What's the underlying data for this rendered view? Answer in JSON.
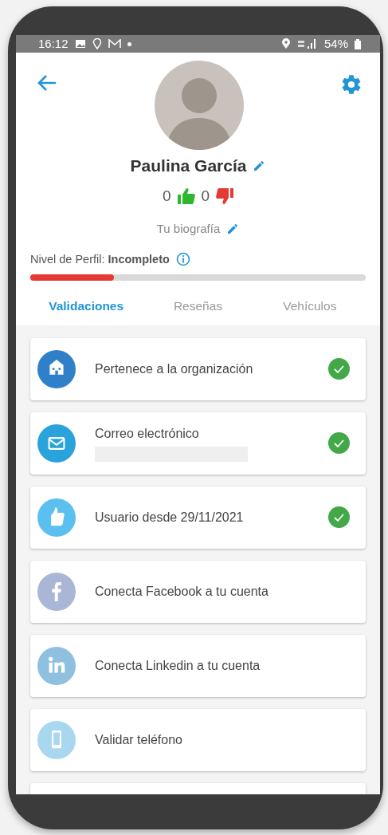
{
  "status_bar": {
    "time": "16:12",
    "battery": "54%"
  },
  "profile": {
    "name": "Paulina García",
    "likes": "0",
    "dislikes": "0",
    "bio_placeholder": "Tu biografía"
  },
  "profile_level": {
    "label": "Nivel de Perfil:",
    "value": "Incompleto",
    "level": 0.25
  },
  "tabs": [
    {
      "label": "Validaciones",
      "selected": true
    },
    {
      "label": "Reseñas",
      "selected": false
    },
    {
      "label": "Vehículos",
      "selected": false
    }
  ],
  "validations": [
    {
      "kind": "organization",
      "title": "Pertenece a la organización",
      "verified": true,
      "hidden_value": false
    },
    {
      "kind": "email",
      "title": "Correo electrónico",
      "verified": true,
      "hidden_value": true
    },
    {
      "kind": "member",
      "title": "Usuario desde 29/11/2021",
      "verified": true,
      "hidden_value": false
    },
    {
      "kind": "facebook",
      "title": "Conecta Facebook a tu cuenta",
      "verified": false,
      "hidden_value": false
    },
    {
      "kind": "linkedin",
      "title": "Conecta Linkedin a tu cuenta",
      "verified": false,
      "hidden_value": false
    },
    {
      "kind": "phone",
      "title": "Validar teléfono",
      "verified": false,
      "hidden_value": false
    }
  ]
}
